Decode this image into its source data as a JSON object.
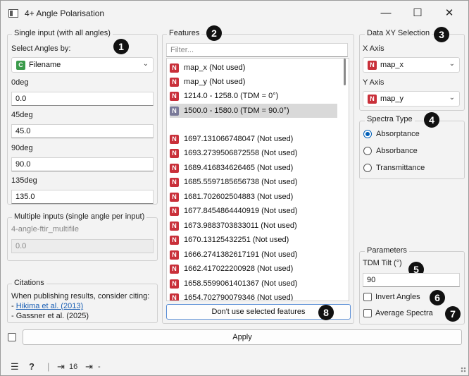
{
  "window": {
    "title": "4+ Angle Polarisation",
    "minimize": "—",
    "maximize": "☐",
    "close": "✕"
  },
  "single_input": {
    "title": "Single input (with all angles)",
    "select_label": "Select Angles by:",
    "select_value": "Filename",
    "select_icon_letter": "C",
    "angles": [
      {
        "label": "0deg",
        "value": "0.0"
      },
      {
        "label": "45deg",
        "value": "45.0"
      },
      {
        "label": "90deg",
        "value": "90.0"
      },
      {
        "label": "135deg",
        "value": "135.0"
      }
    ]
  },
  "multiple_inputs": {
    "title": "Multiple inputs (single angle per input)",
    "label": "4-angle-ftir_multifile",
    "value": "0.0"
  },
  "citations": {
    "title": "Citations",
    "intro": "When publishing results, consider citing:",
    "dash": "- ",
    "items": [
      "Hikima et al. (2013)",
      "Gassner et al. (2025)"
    ]
  },
  "features": {
    "title": "Features",
    "filter_placeholder": "Filter...",
    "items": [
      {
        "text": "map_x (Not used)"
      },
      {
        "text": "map_y (Not used)"
      },
      {
        "text": "1214.0 - 1258.0 (TDM = 0°)"
      },
      {
        "text": "1500.0 - 1580.0 (TDM = 90.0°)"
      },
      {
        "text": ""
      },
      {
        "text": "1697.131066748047 (Not used)"
      },
      {
        "text": "1693.2739506872558 (Not used)"
      },
      {
        "text": "1689.416834626465 (Not used)"
      },
      {
        "text": "1685.5597185656738 (Not used)"
      },
      {
        "text": "1681.702602504883 (Not used)"
      },
      {
        "text": "1677.8454864440919 (Not used)"
      },
      {
        "text": "1673.9883703833011 (Not used)"
      },
      {
        "text": "1670.13125432251 (Not used)"
      },
      {
        "text": "1666.2741382617191 (Not used)"
      },
      {
        "text": "1662.417022200928 (Not used)"
      },
      {
        "text": "1658.5599061401367 (Not used)"
      },
      {
        "text": "1654.702790079346 (Not used)"
      }
    ],
    "icon_letter": "N",
    "button": "Don't use selected features"
  },
  "data_xy": {
    "title": "Data XY Selection",
    "x_label": "X Axis",
    "x_value": "map_x",
    "y_label": "Y Axis",
    "y_value": "map_y",
    "icon_letter": "N"
  },
  "spectra_type": {
    "title": "Spectra Type",
    "options": [
      "Absorptance",
      "Absorbance",
      "Transmittance"
    ],
    "selected": "Absorptance"
  },
  "parameters": {
    "title": "Parameters",
    "tdm_label": "TDM Tilt (°)",
    "tdm_value": "90",
    "invert_label": "Invert Angles",
    "average_label": "Average Spectra"
  },
  "badges": [
    "1",
    "2",
    "3",
    "4",
    "5",
    "6",
    "7",
    "8"
  ],
  "apply": "Apply",
  "statusbar": {
    "menu_icon": "☰",
    "help_icon": "?",
    "input_count": "16",
    "output_count": "-"
  },
  "colors": {
    "n_icon": "#c9303a",
    "c_icon": "#3a9a4a",
    "accent": "#005fb8"
  }
}
